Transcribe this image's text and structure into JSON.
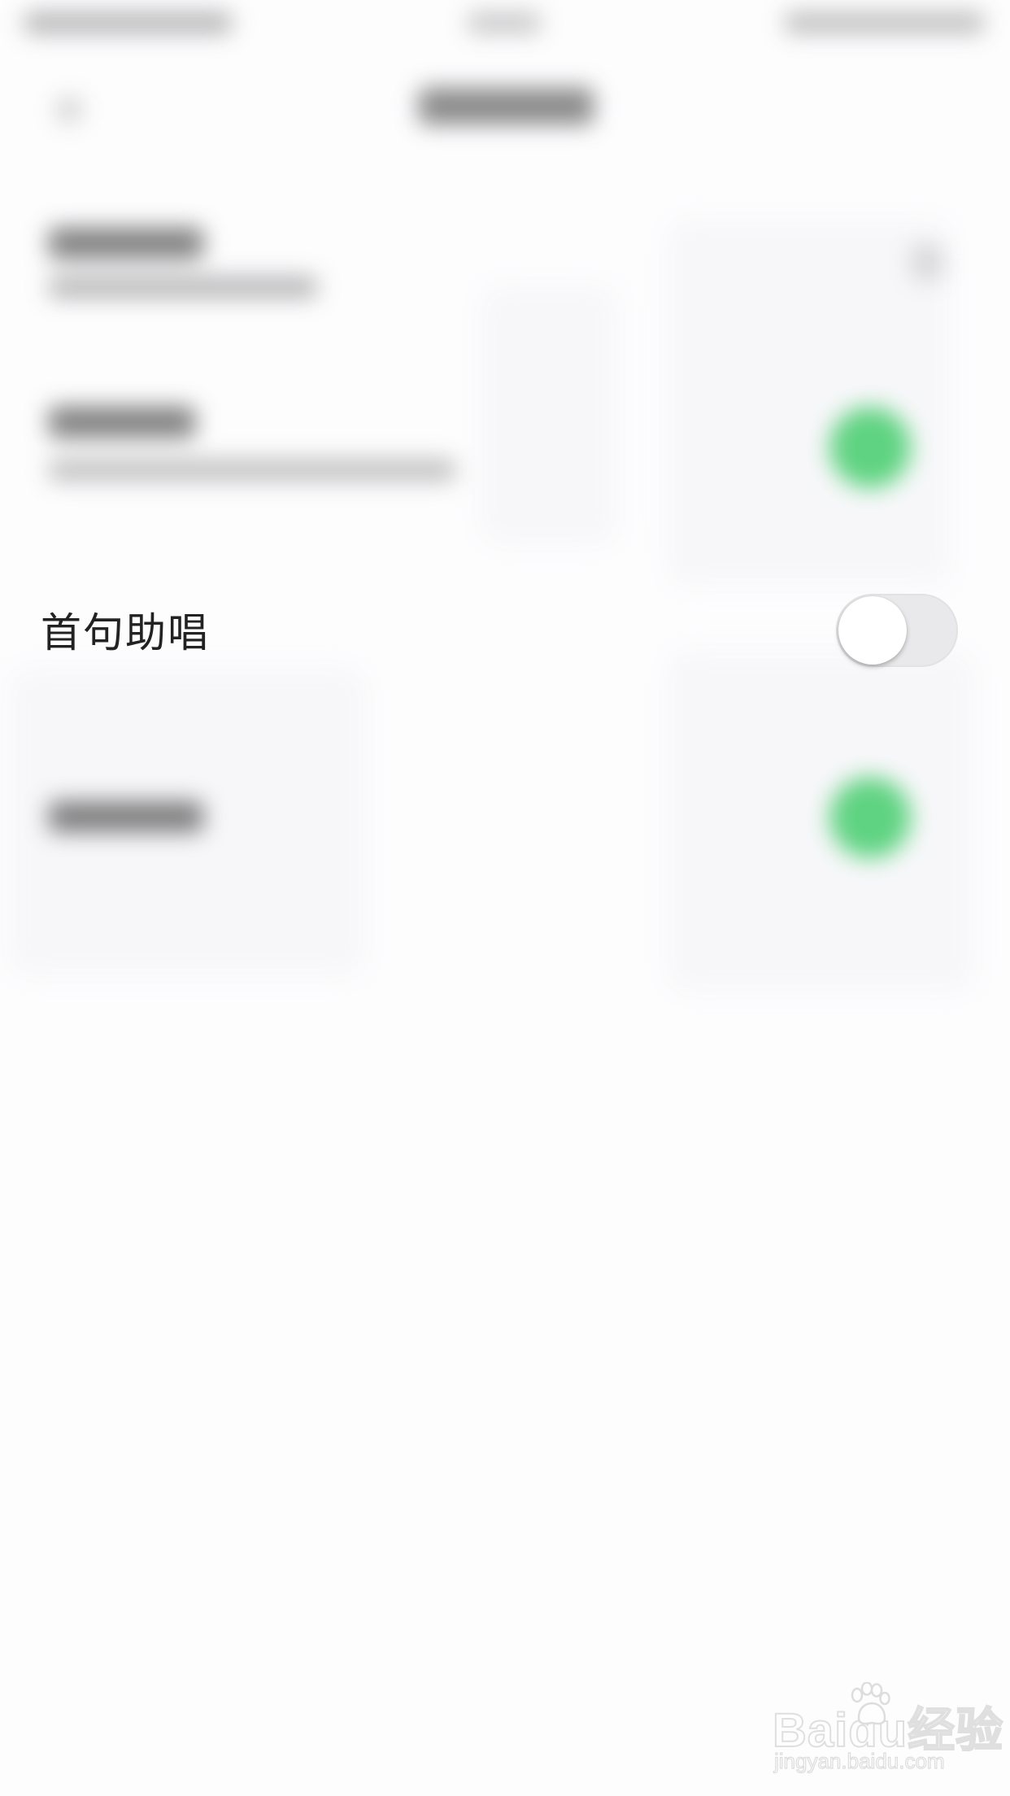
{
  "settings": {
    "rows": [
      {
        "label": "首句助唱",
        "toggle_on": false
      }
    ]
  },
  "watermark": {
    "brand": "Baidu经验",
    "url": "jingyan.baidu.com"
  },
  "colors": {
    "toggle_on": "#34c759",
    "toggle_off_track": "#e9e9eb",
    "background": "#fdfdfe"
  }
}
